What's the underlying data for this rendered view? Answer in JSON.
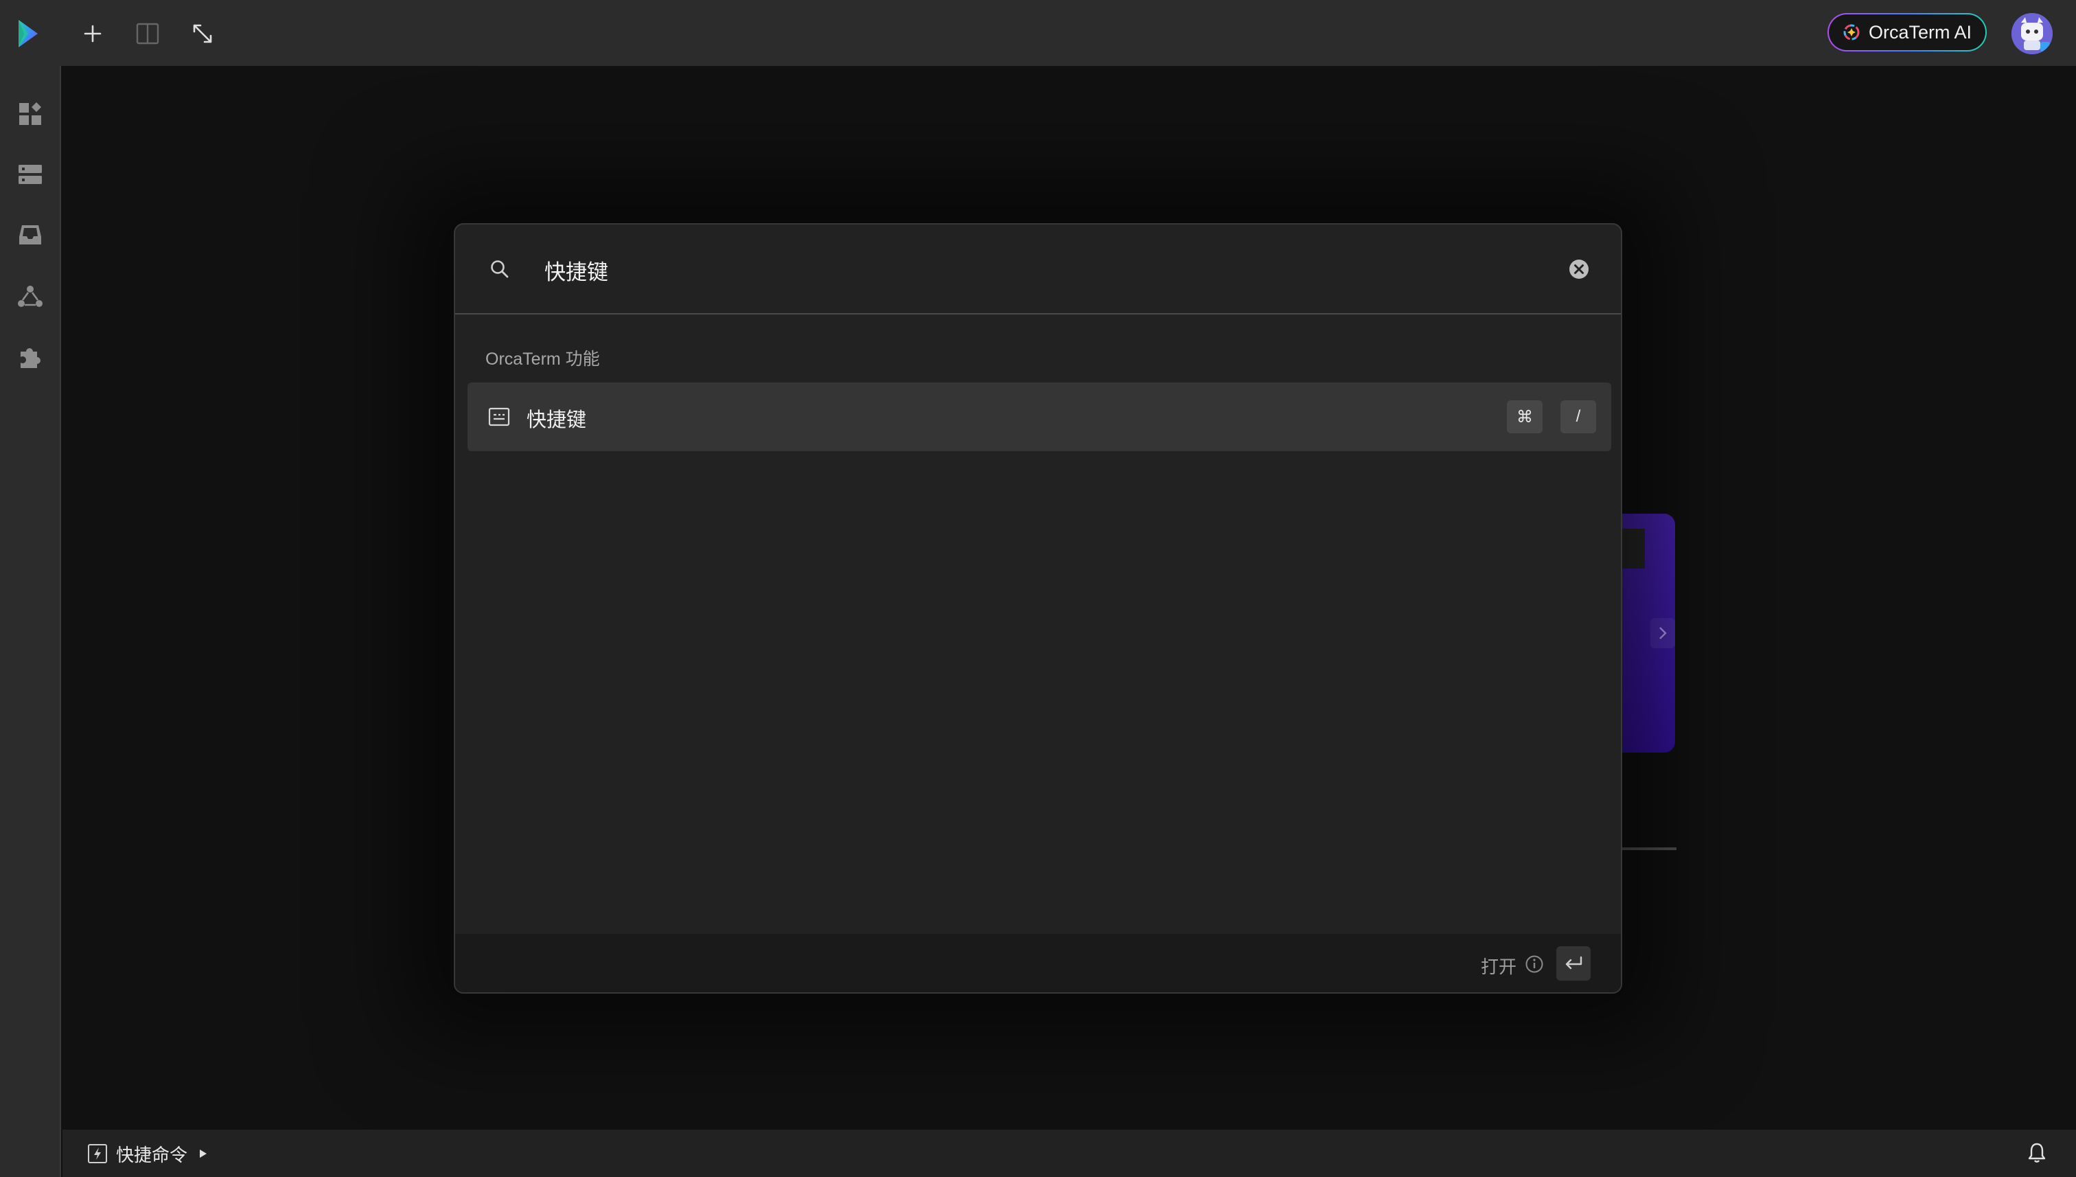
{
  "header": {
    "ai_button_label": "OrcaTerm AI"
  },
  "search": {
    "query": "快捷键"
  },
  "results": {
    "section_title": "OrcaTerm 功能",
    "items": [
      {
        "label": "快捷键",
        "icon": "keyboard-icon",
        "shortcut": [
          "⌘",
          "/"
        ]
      }
    ]
  },
  "footer": {
    "open_label": "打开"
  },
  "statusbar": {
    "quick_command_label": "快捷命令"
  },
  "colors": {
    "accent_gradient": [
      "#b14df0",
      "#4d7cfe",
      "#1fd1b5"
    ],
    "background": "#111111",
    "panel": "#222222",
    "selected_row": "#353535"
  }
}
